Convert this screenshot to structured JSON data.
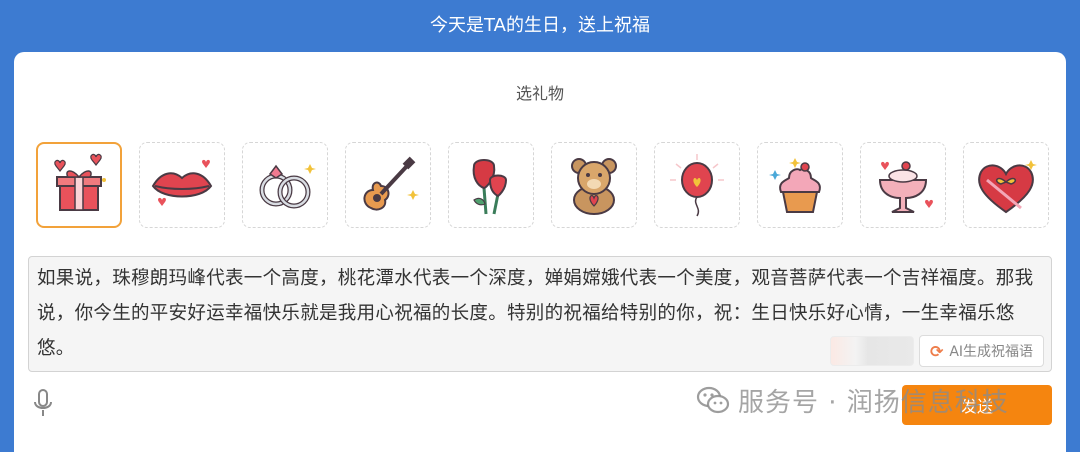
{
  "header": {
    "title": "今天是TA的生日，送上祝福"
  },
  "gift_section": {
    "title": "选礼物",
    "gifts": [
      {
        "icon": "gift-box-icon",
        "selected": true
      },
      {
        "icon": "lips-icon",
        "selected": false
      },
      {
        "icon": "rings-icon",
        "selected": false
      },
      {
        "icon": "guitar-icon",
        "selected": false
      },
      {
        "icon": "roses-icon",
        "selected": false
      },
      {
        "icon": "teddy-bear-icon",
        "selected": false
      },
      {
        "icon": "balloon-icon",
        "selected": false
      },
      {
        "icon": "cupcake-icon",
        "selected": false
      },
      {
        "icon": "dessert-cup-icon",
        "selected": false
      },
      {
        "icon": "heart-gift-icon",
        "selected": false
      }
    ]
  },
  "message": {
    "text": "如果说，珠穆朗玛峰代表一个高度，桃花潭水代表一个深度，婵娟嫦娥代表一个美度，观音菩萨代表一个吉祥福度。那我说，你今生的平安好运幸福快乐就是我用心祝福的长度。特别的祝福给特别的你，祝：生日快乐好心情，一生幸福乐悠悠。"
  },
  "ai_button": {
    "label": "AI生成祝福语",
    "icon": "refresh-icon"
  },
  "footer": {
    "mic_icon": "microphone-icon",
    "send_label": "发送"
  },
  "watermark": {
    "text": "服务号 · 润扬信息科技",
    "icon": "wechat-icon"
  },
  "colors": {
    "header_bg": "#3d7bd1",
    "accent": "#f5850f",
    "selected_border": "#f2a23a"
  }
}
